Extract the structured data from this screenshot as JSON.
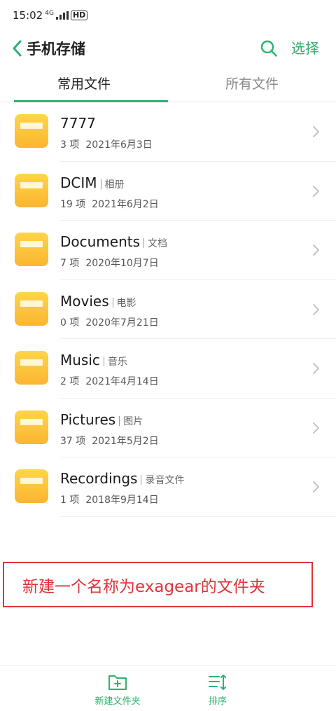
{
  "status_bar": {
    "time": "15:02",
    "network": "4G",
    "hd": "HD"
  },
  "header": {
    "title": "手机存储",
    "select_label": "选择"
  },
  "tabs": [
    {
      "label": "常用文件",
      "active": true
    },
    {
      "label": "所有文件",
      "active": false
    }
  ],
  "folders": [
    {
      "name": "7777",
      "alias": "",
      "count": "3 项",
      "date": "2021年6月3日"
    },
    {
      "name": "DCIM",
      "alias": "相册",
      "count": "19 项",
      "date": "2021年6月2日"
    },
    {
      "name": "Documents",
      "alias": "文档",
      "count": "7 项",
      "date": "2020年10月7日"
    },
    {
      "name": "Movies",
      "alias": "电影",
      "count": "0 项",
      "date": "2020年7月21日"
    },
    {
      "name": "Music",
      "alias": "音乐",
      "count": "2 项",
      "date": "2021年4月14日"
    },
    {
      "name": "Pictures",
      "alias": "图片",
      "count": "37 项",
      "date": "2021年5月2日"
    },
    {
      "name": "Recordings",
      "alias": "录音文件",
      "count": "1 项",
      "date": "2018年9月14日"
    }
  ],
  "instruction": "新建一个名称为exagear的文件夹",
  "bottom_bar": {
    "new_folder_label": "新建文件夹",
    "sort_label": "排序"
  },
  "colors": {
    "accent": "#2fb170",
    "folder": "#fbb531",
    "annotation": "#e0333a"
  },
  "icons": {
    "back": "chevron-left-icon",
    "search": "search-icon",
    "folder": "folder-icon",
    "chevron": "chevron-right-icon",
    "new_folder": "folder-plus-icon",
    "sort": "sort-icon"
  }
}
